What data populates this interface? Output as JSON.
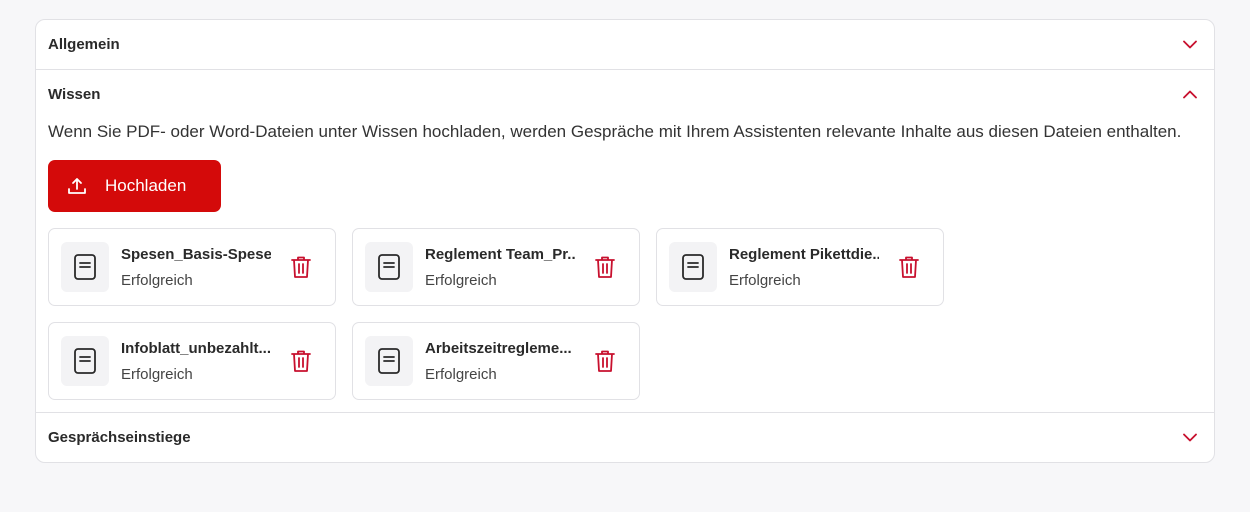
{
  "sections": {
    "general": {
      "title": "Allgemein",
      "icon": "chevron-down-icon"
    },
    "knowledge": {
      "title": "Wissen",
      "icon": "chevron-up-icon",
      "description": "Wenn Sie PDF- oder Word-Dateien unter Wissen hochladen, werden Gespräche mit Ihrem Assistenten relevante Inhalte aus diesen Dateien enthalten.",
      "upload_label": "Hochladen",
      "files": [
        {
          "name": "Spesen_Basis-Spese...",
          "status": "Erfolgreich"
        },
        {
          "name": "Reglement Team_Pr...",
          "status": "Erfolgreich"
        },
        {
          "name": "Reglement Pikettdie...",
          "status": "Erfolgreich"
        },
        {
          "name": "Infoblatt_unbezahlt...",
          "status": "Erfolgreich"
        },
        {
          "name": "Arbeitszeitregleme...",
          "status": "Erfolgreich"
        }
      ]
    },
    "conversation_starters": {
      "title": "Gesprächseinstiege",
      "icon": "chevron-down-icon"
    }
  },
  "colors": {
    "accent": "#d40a0a",
    "border": "#e1e1e5",
    "background": "#f7f7f9"
  }
}
